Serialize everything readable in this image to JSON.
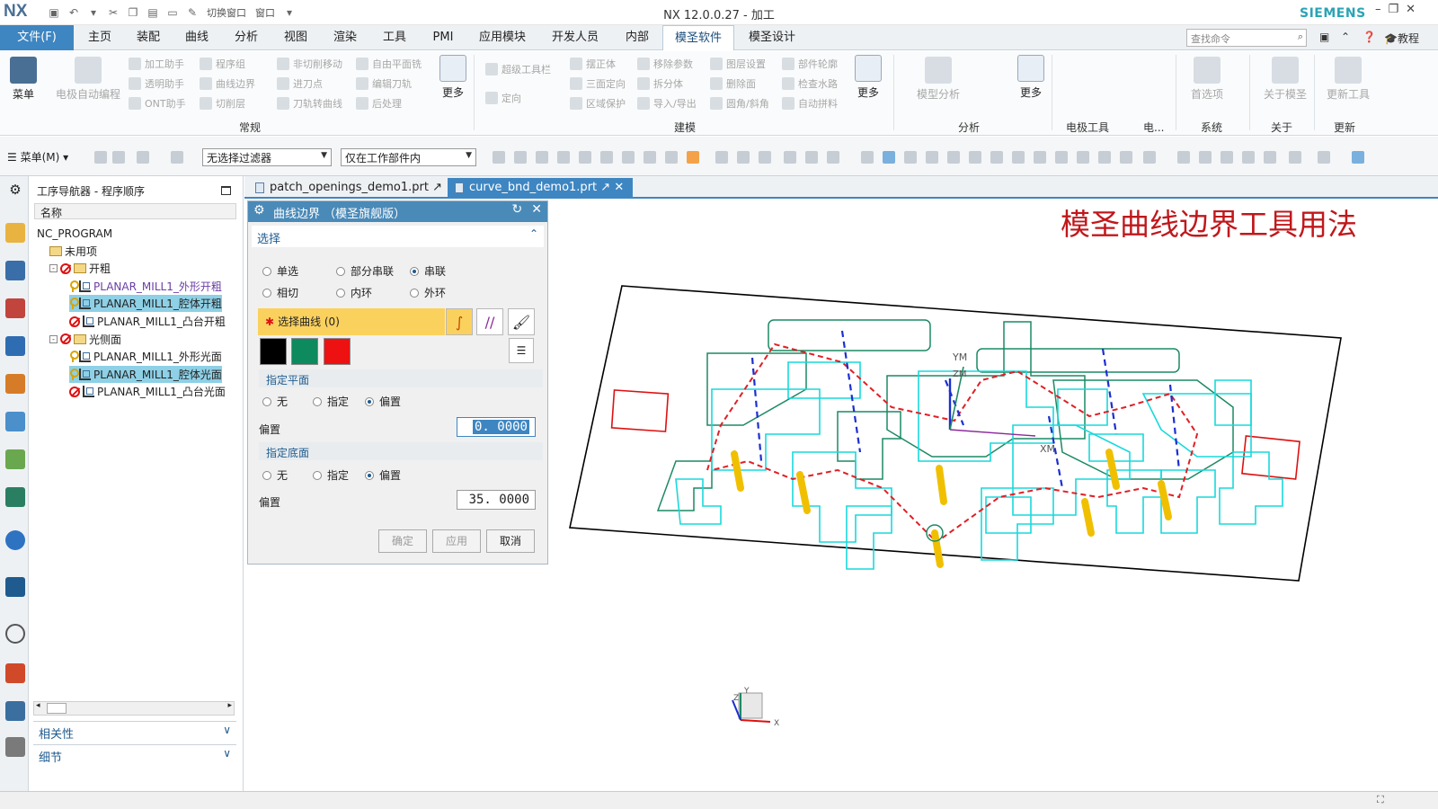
{
  "app": {
    "logo": "NX",
    "window_title": "NX 12.0.0.27 - 加工",
    "brand": "SIEMENS",
    "qat_switch_window": "切换窗口",
    "qat_window": "窗口"
  },
  "menu": {
    "tabs": [
      "文件(F)",
      "主页",
      "装配",
      "曲线",
      "分析",
      "视图",
      "渲染",
      "工具",
      "PMI",
      "应用模块",
      "开发人员",
      "内部",
      "模圣软件",
      "模圣设计"
    ],
    "active_tab": "模圣软件",
    "search_placeholder": "查找命令",
    "tutorial": "教程"
  },
  "ribbon": {
    "menu_label": "菜单",
    "electrode_auto": "电极自动编程",
    "group1_items": [
      "加工助手",
      "程序组",
      "非切削移动",
      "自由平面铣",
      "透明助手",
      "曲线边界",
      "进刀点",
      "编辑刀轨",
      "ONT助手",
      "切削层",
      "刀轨转曲线",
      "后处理"
    ],
    "more": "更多",
    "group1_label": "常规",
    "group2_items": [
      "超级工具栏",
      "定向",
      "摆正体",
      "移除参数",
      "图层设置",
      "部件轮廓",
      "三面定向",
      "拆分体",
      "删除面",
      "检查水路",
      "区域保护",
      "导入/导出",
      "圆角/斜角",
      "自动拼料"
    ],
    "group2_label": "建模",
    "model_analysis": "模型分析",
    "group3_label": "分析",
    "group4_label": "电极工具",
    "group5_label": "电...",
    "preferences": "首选项",
    "group6_label": "系统",
    "about": "关于模圣",
    "group7_label": "关于",
    "update_tools": "更新工具",
    "group8_label": "更新"
  },
  "toolbar2": {
    "menu_button": "菜单(M)",
    "filter": "无选择过滤器",
    "scope": "仅在工作部件内"
  },
  "navigator": {
    "title": "工序导航器 - 程序顺序",
    "column": "名称",
    "rows": [
      {
        "label": "NC_PROGRAM",
        "indent": 0,
        "icon": "none",
        "highlight": false,
        "style": "normal"
      },
      {
        "label": "未用项",
        "indent": 1,
        "icon": "folder",
        "highlight": false,
        "style": "normal"
      },
      {
        "label": "开粗",
        "indent": 1,
        "icon": "no-folder",
        "highlight": false,
        "style": "normal",
        "toggle": "-"
      },
      {
        "label": "PLANAR_MILL1_外形开粗",
        "indent": 2,
        "icon": "key-op",
        "highlight": false,
        "style": "purple"
      },
      {
        "label": "PLANAR_MILL1_腔体开粗",
        "indent": 2,
        "icon": "key-op",
        "highlight": true,
        "style": "normal"
      },
      {
        "label": "PLANAR_MILL1_凸台开粗",
        "indent": 2,
        "icon": "no-op",
        "highlight": false,
        "style": "normal"
      },
      {
        "label": "光侧面",
        "indent": 1,
        "icon": "no-folder",
        "highlight": false,
        "style": "normal",
        "toggle": "-"
      },
      {
        "label": "PLANAR_MILL1_外形光面",
        "indent": 2,
        "icon": "key-op",
        "highlight": false,
        "style": "normal"
      },
      {
        "label": "PLANAR_MILL1_腔体光面",
        "indent": 2,
        "icon": "key-op",
        "highlight": true,
        "style": "normal"
      },
      {
        "label": "PLANAR_MILL1_凸台光面",
        "indent": 2,
        "icon": "no-op",
        "highlight": false,
        "style": "normal"
      }
    ],
    "dependencies": "相关性",
    "details": "细节"
  },
  "file_tabs": [
    "patch_openings_demo1.prt",
    "curve_bnd_demo1.prt"
  ],
  "active_file_tab": 1,
  "dialog": {
    "title": "曲线边界 （模圣旗舰版）",
    "section_select": "选择",
    "modes": [
      "单选",
      "部分串联",
      "串联",
      "相切",
      "内环",
      "外环"
    ],
    "selected_mode": "串联",
    "select_curve": "选择曲线 (0)",
    "swatch_colors": [
      "#000000",
      "#0d8a5e",
      "#ee1111"
    ],
    "specify_plane": "指定平面",
    "plane_options": [
      "无",
      "指定",
      "偏置"
    ],
    "plane_selected": "偏置",
    "offset_label": "偏置",
    "plane_offset": "0. 0000",
    "specify_floor": "指定底面",
    "floor_options": [
      "无",
      "指定",
      "偏置"
    ],
    "floor_selected": "偏置",
    "floor_offset": "35. 0000",
    "ok": "确定",
    "apply": "应用",
    "cancel": "取消"
  },
  "viewport": {
    "overlay_title": "模圣曲线边界工具用法",
    "axis_labels": [
      "YM",
      "ZM",
      "XM"
    ],
    "triad_labels": [
      "Y",
      "Z",
      "X"
    ],
    "colors": {
      "outline": "#000000",
      "green_curves": "#1c8a63",
      "cyan_curves": "#19d8dc",
      "red_path": "#e01f26",
      "blue_path": "#1b2fd0",
      "yellow_tool": "#f0c000"
    }
  }
}
